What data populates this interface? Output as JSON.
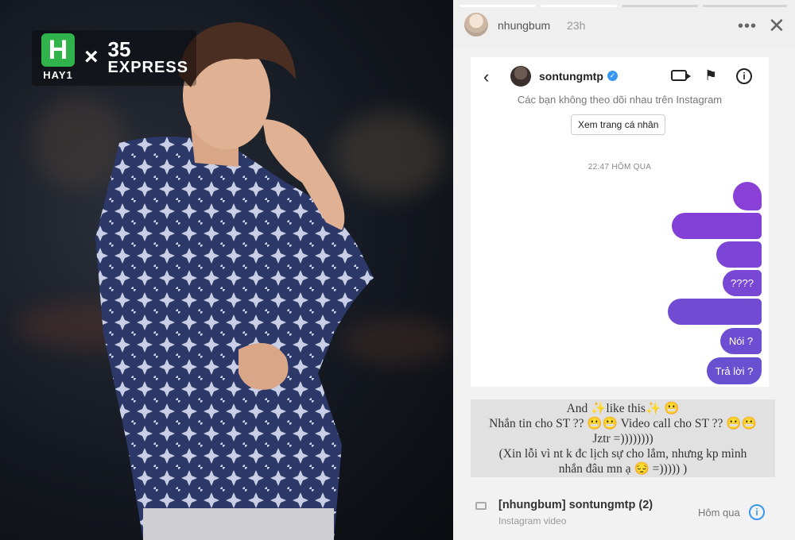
{
  "brand": {
    "logo_letter": "H",
    "logo_caption": "HAY1",
    "times": "×",
    "partner_number": "35",
    "partner_word": "EXPRESS",
    "accent": "#2fb34a"
  },
  "story": {
    "username": "nhungbum",
    "time": "23h",
    "more": "•••",
    "close": "✕",
    "progress_segments": 4,
    "progress_done": 2
  },
  "dm": {
    "back": "‹",
    "username": "sontungmtp",
    "verified": "✓",
    "flag": "⚑",
    "info": "i",
    "notice": "Các bạn không theo dõi nhau trên Instagram",
    "profile_button": "Xem trang cá nhân",
    "timestamp": "22:47 HÔM QUA",
    "bubble_color_top": "#8a3fd6",
    "bubble_color_bottom": "#6a4fd0",
    "messages": [
      {
        "text": ""
      },
      {
        "text": ""
      },
      {
        "text": ""
      },
      {
        "text": "????"
      },
      {
        "text": ""
      },
      {
        "text": "Nói ?"
      },
      {
        "text": "Trả lời ?"
      }
    ]
  },
  "caption": {
    "lines": [
      "And ✨like this✨ 😬",
      "Nhắn tin cho ST ?? 😬😬 Video call cho ST ?? 😬😬",
      "Jztr =))))))))",
      "(Xin lỗi vì nt k đc lịch sự cho lắm, nhưng kp mình",
      "nhắn đâu mn ạ 😔 =))))) )"
    ]
  },
  "notification": {
    "title": "[nhungbum] sontungmtp (2)",
    "subtitle": "Instagram video",
    "when": "Hôm qua",
    "info": "i"
  }
}
